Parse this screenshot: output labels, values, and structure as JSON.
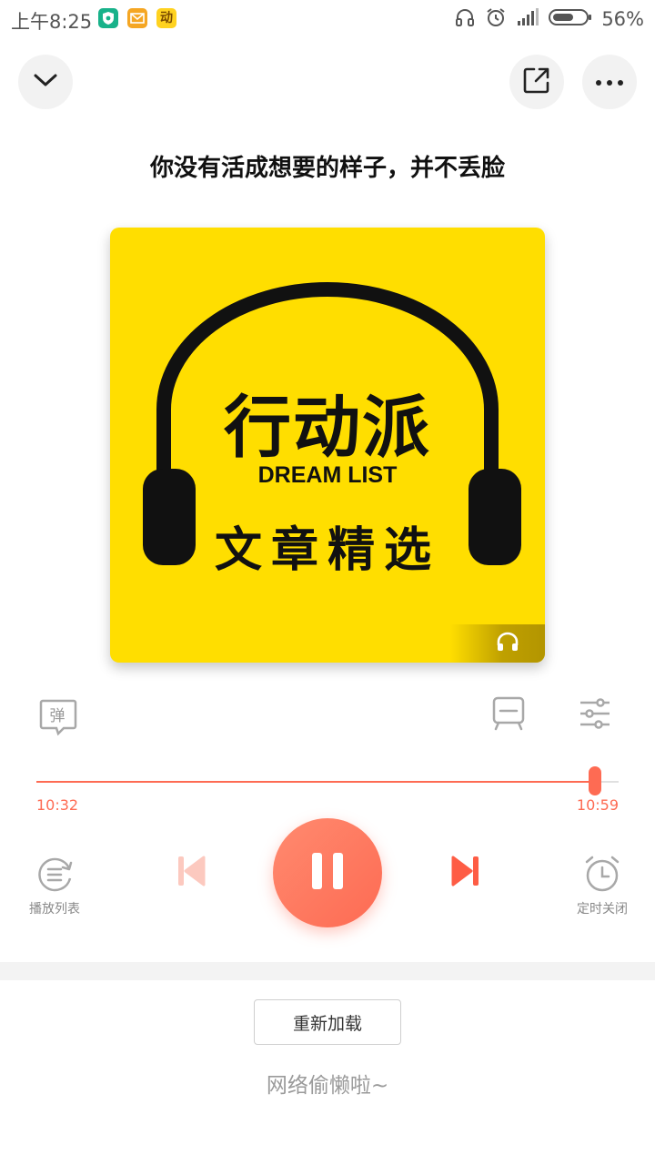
{
  "status_bar": {
    "time": "上午8:25",
    "battery_text": "56%",
    "battery_level": 0.56,
    "apps": [
      "shield-app-icon",
      "mail-app-icon",
      "dong-app-icon"
    ],
    "app_badge_text": "动"
  },
  "header": {
    "title": "你没有活成想要的样子，并不丢脸"
  },
  "cover": {
    "title_cn": "行动派",
    "subtitle_en": "DREAM LIST",
    "subtitle_cn": "文章精选",
    "background_color": "#ffde00"
  },
  "actions": {
    "danmaku_label": "弹"
  },
  "player": {
    "current_time": "10:32",
    "total_time": "10:59",
    "progress": 0.96,
    "accent_color": "#fe6b53",
    "playlist_label": "播放列表",
    "timer_label": "定时关闭"
  },
  "footer": {
    "reload_label": "重新加载",
    "network_message": "网络偷懒啦~"
  }
}
